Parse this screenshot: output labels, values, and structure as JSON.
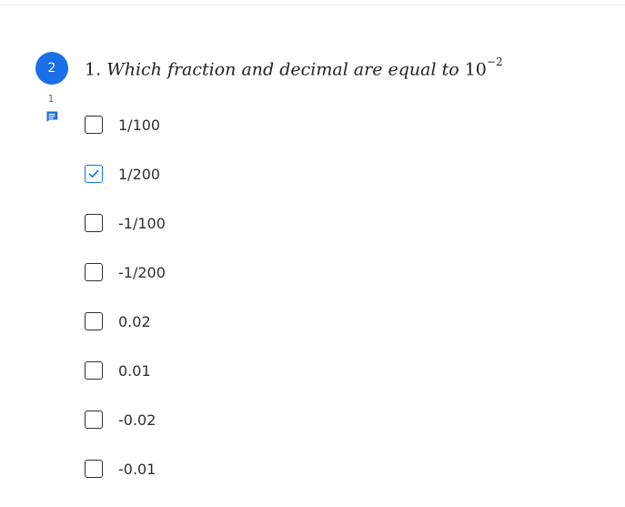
{
  "question": {
    "badge": "2",
    "number": "1.",
    "text": "Which fraction and decimal are equal to",
    "base": "10",
    "exponent": "−2",
    "comment_count": "1"
  },
  "options": [
    {
      "label": "1/100",
      "checked": false
    },
    {
      "label": "1/200",
      "checked": true
    },
    {
      "label": "-1/100",
      "checked": false
    },
    {
      "label": "-1/200",
      "checked": false
    },
    {
      "label": "0.02",
      "checked": false
    },
    {
      "label": "0.01",
      "checked": false
    },
    {
      "label": "-0.02",
      "checked": false
    },
    {
      "label": "-0.01",
      "checked": false
    }
  ],
  "icons": {
    "comment": "comment-icon",
    "check": "checkmark-icon"
  },
  "colors": {
    "accent": "#1a6fe6",
    "text": "#2b2f36",
    "muted": "#666a70"
  }
}
